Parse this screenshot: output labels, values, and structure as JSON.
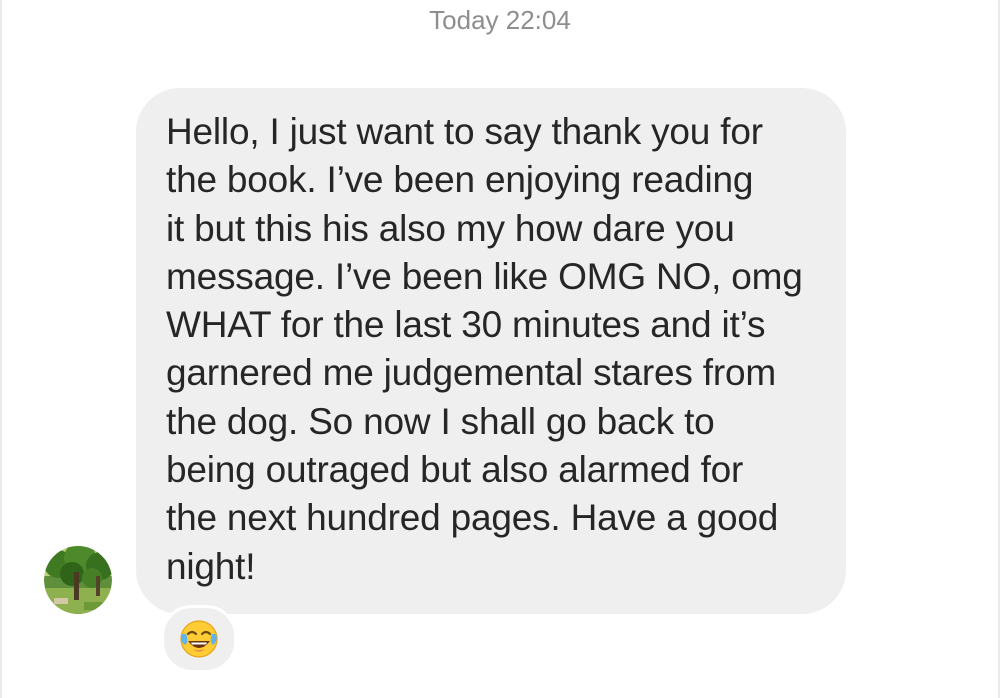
{
  "conversation": {
    "timestamp": "Today 22:04",
    "message": {
      "lines": [
        "Hello, I just want to say thank you for",
        "the book. I’ve been enjoying reading",
        "it but this his also my how dare you",
        "message. I’ve been like OMG NO, omg",
        "WHAT for the last 30 minutes and it’s",
        "garnered me judgemental stares from",
        "the dog. So now I shall go back to",
        "being outraged but also alarmed for",
        "the next hundred pages. Have a good",
        "night!"
      ],
      "reaction_icon": "face-with-tears-of-joy-icon",
      "sender_avatar": "tree-photo-avatar"
    }
  },
  "colors": {
    "bubble_background": "#efefef",
    "timestamp_text": "#8e8e8e",
    "message_text": "#262626",
    "page_background": "#ffffff"
  }
}
